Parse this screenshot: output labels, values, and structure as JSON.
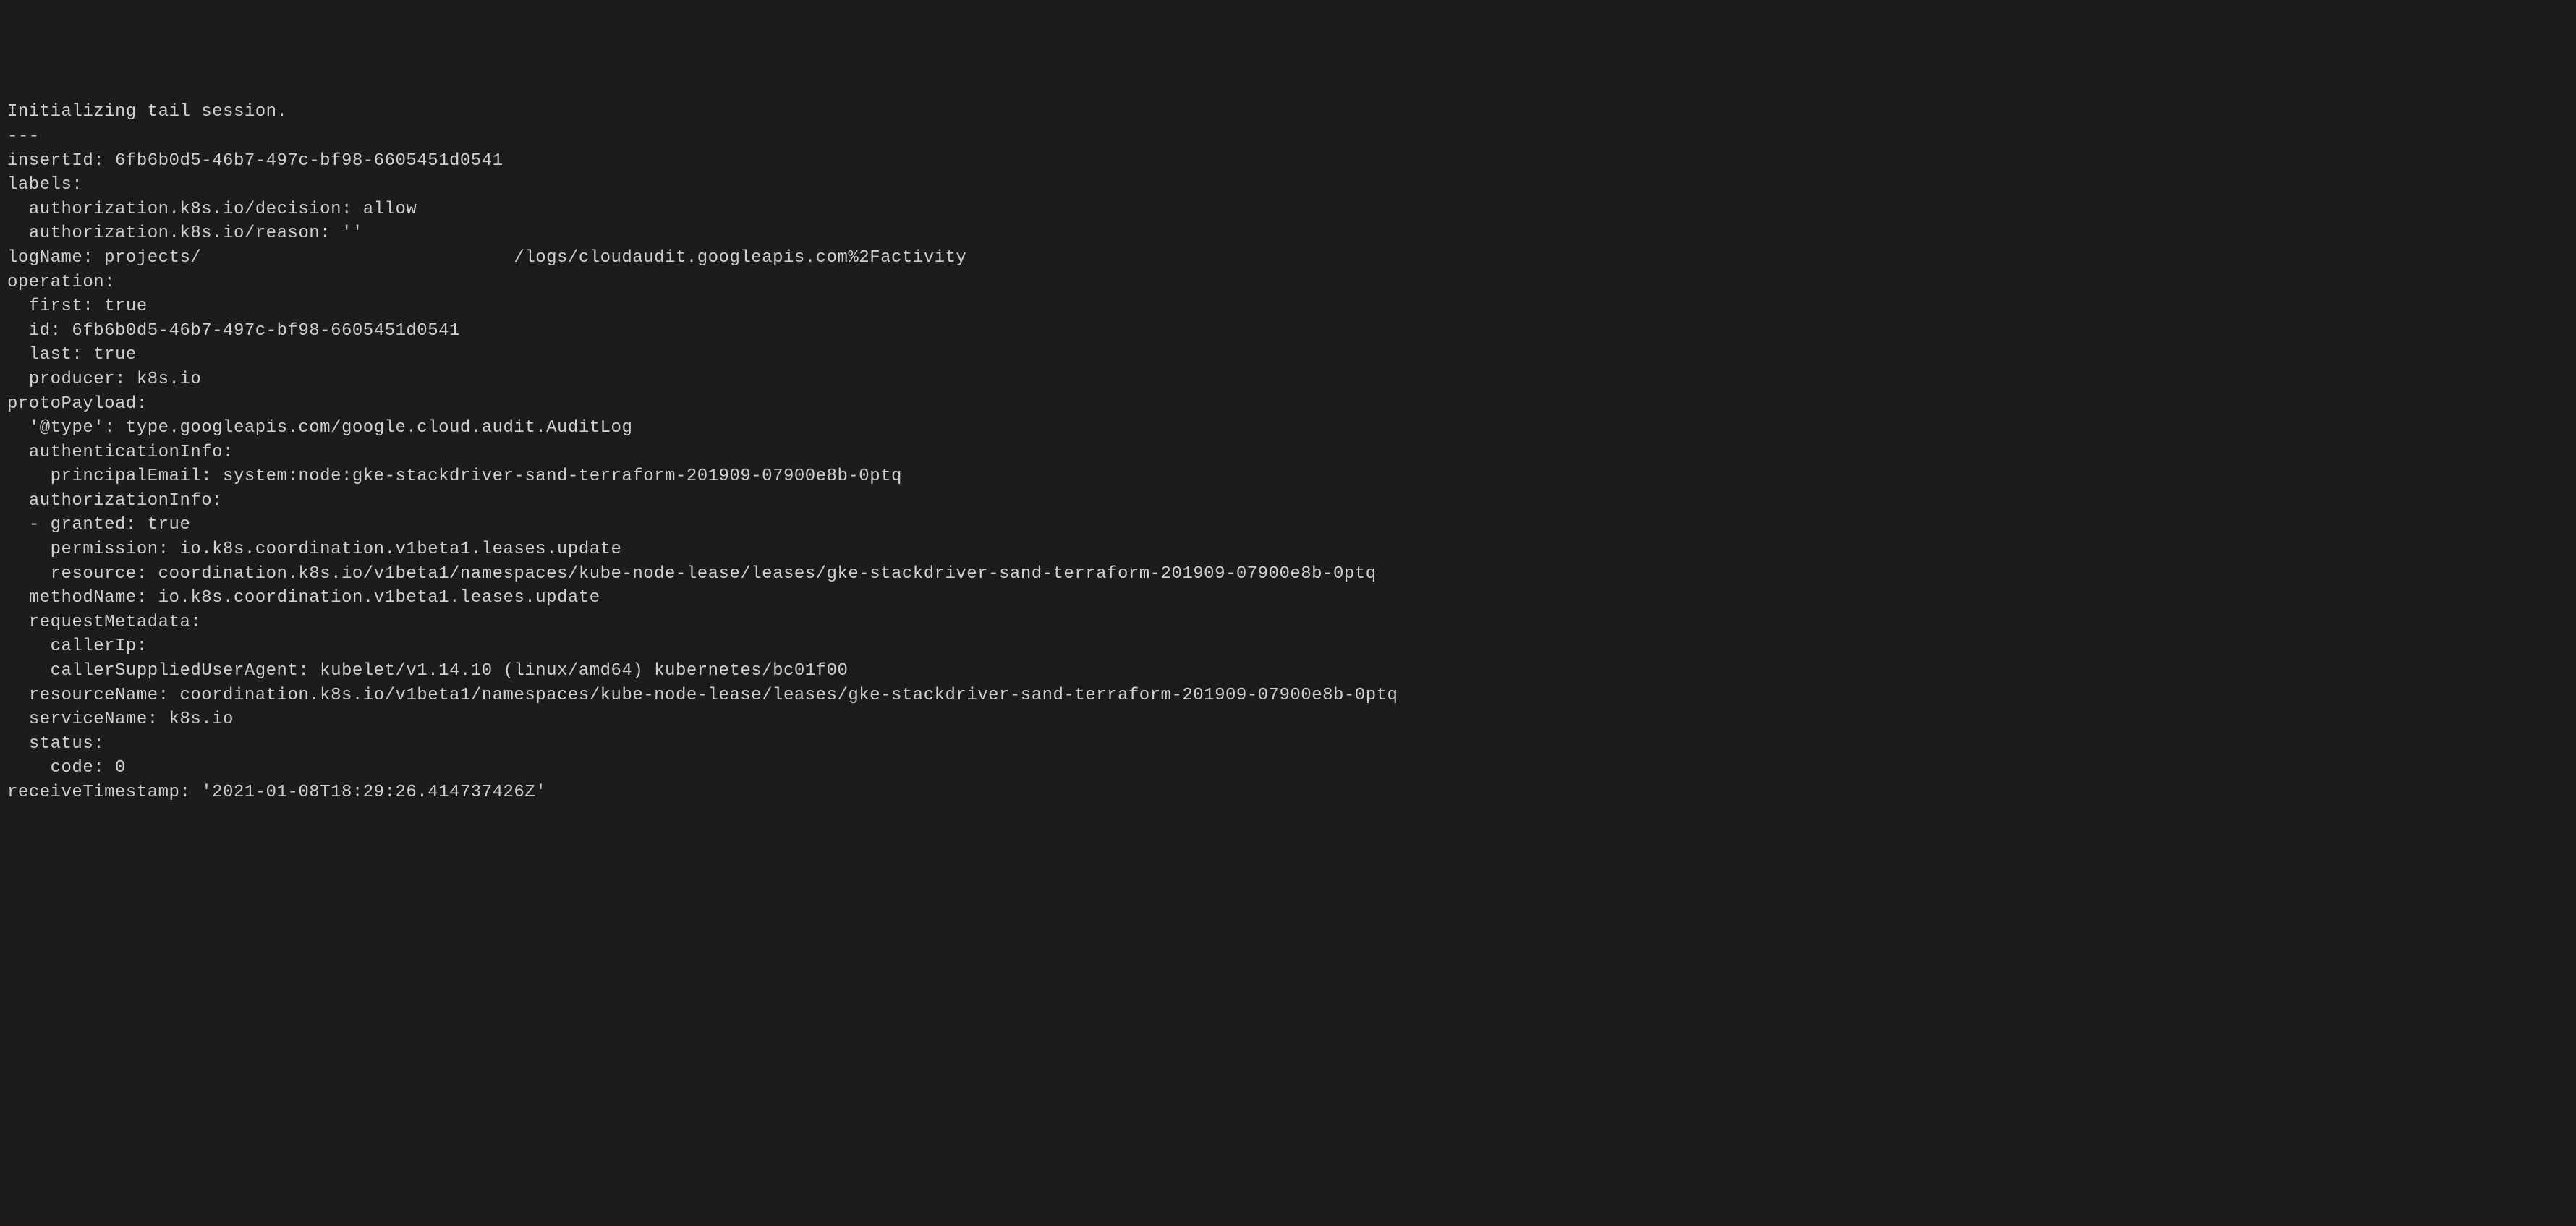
{
  "terminal": {
    "lines": [
      "Initializing tail session.",
      "---",
      "insertId: 6fb6b0d5-46b7-497c-bf98-6605451d0541",
      "labels:",
      "  authorization.k8s.io/decision: allow",
      "  authorization.k8s.io/reason: ''",
      "logName: projects/                             /logs/cloudaudit.googleapis.com%2Factivity",
      "operation:",
      "  first: true",
      "  id: 6fb6b0d5-46b7-497c-bf98-6605451d0541",
      "  last: true",
      "  producer: k8s.io",
      "protoPayload:",
      "  '@type': type.googleapis.com/google.cloud.audit.AuditLog",
      "  authenticationInfo:",
      "    principalEmail: system:node:gke-stackdriver-sand-terraform-201909-07900e8b-0ptq",
      "  authorizationInfo:",
      "  - granted: true",
      "    permission: io.k8s.coordination.v1beta1.leases.update",
      "    resource: coordination.k8s.io/v1beta1/namespaces/kube-node-lease/leases/gke-stackdriver-sand-terraform-201909-07900e8b-0ptq",
      "  methodName: io.k8s.coordination.v1beta1.leases.update",
      "  requestMetadata:",
      "    callerIp:",
      "    callerSuppliedUserAgent: kubelet/v1.14.10 (linux/amd64) kubernetes/bc01f00",
      "  resourceName: coordination.k8s.io/v1beta1/namespaces/kube-node-lease/leases/gke-stackdriver-sand-terraform-201909-07900e8b-0ptq",
      "  serviceName: k8s.io",
      "  status:",
      "    code: 0",
      "receiveTimestamp: '2021-01-08T18:29:26.414737426Z'"
    ]
  }
}
